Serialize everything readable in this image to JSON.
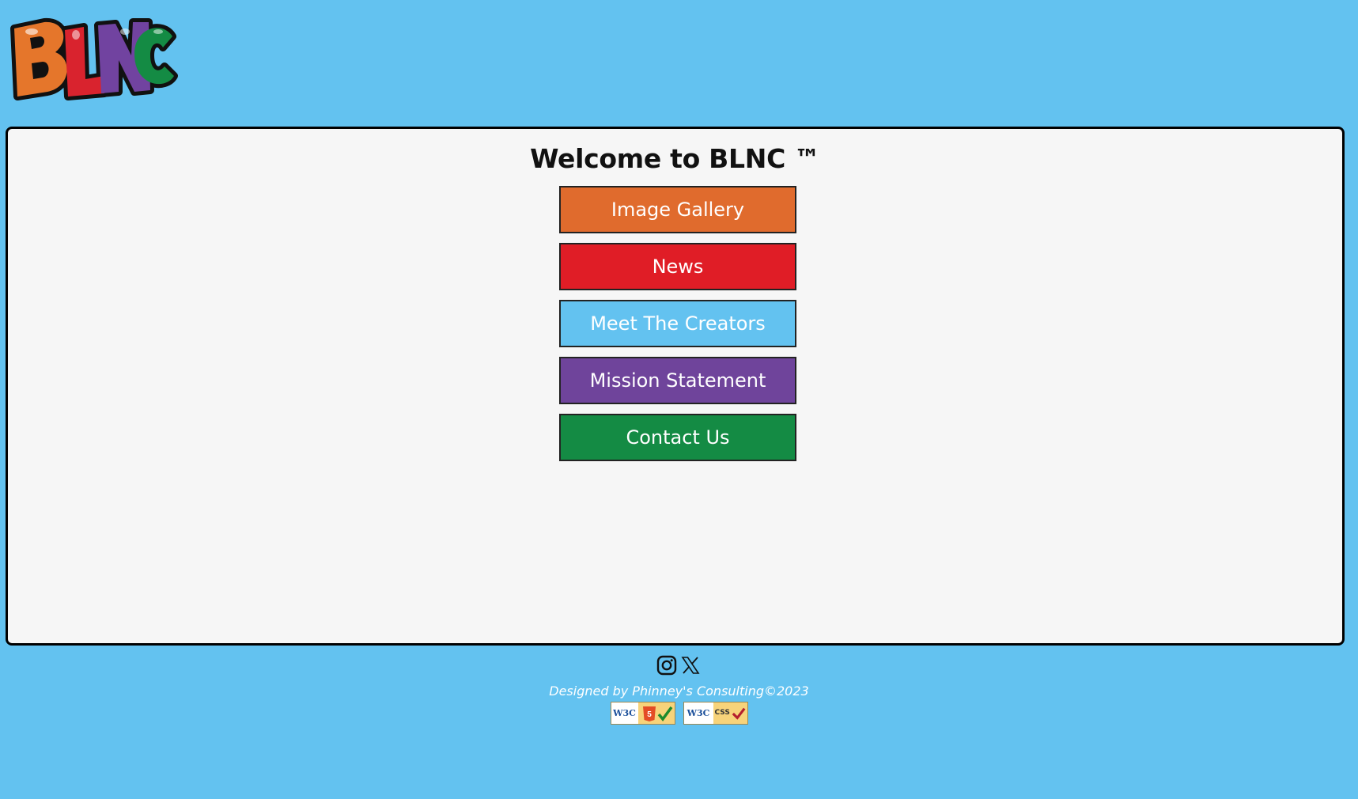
{
  "logo": {
    "alt": "BLNC",
    "letters": [
      "B",
      "L",
      "N",
      "C"
    ],
    "colors": [
      "#e5762b",
      "#d9232e",
      "#7143a0",
      "#148b44"
    ]
  },
  "main": {
    "title": "Welcome to BLNC ™",
    "nav": [
      {
        "label": "Image Gallery",
        "color": "#e06b2d"
      },
      {
        "label": "News",
        "color": "#e01d26"
      },
      {
        "label": "Meet The Creators",
        "color": "#63c2f0"
      },
      {
        "label": "Mission Statement",
        "color": "#6f449b"
      },
      {
        "label": "Contact Us",
        "color": "#148b44"
      }
    ]
  },
  "footer": {
    "social": [
      {
        "icon": "instagram-icon"
      },
      {
        "icon": "x-icon"
      }
    ],
    "credit": "Designed by Phinney's Consulting©2023",
    "badges": [
      {
        "left": "W3C",
        "right": "HTML 5",
        "icon": "html5-valid-badge"
      },
      {
        "left": "W3C",
        "right": "CSS",
        "icon": "css-valid-badge"
      }
    ]
  },
  "colors": {
    "background": "#63c2f0",
    "panel": "#f6f6f6",
    "border": "#000000"
  }
}
